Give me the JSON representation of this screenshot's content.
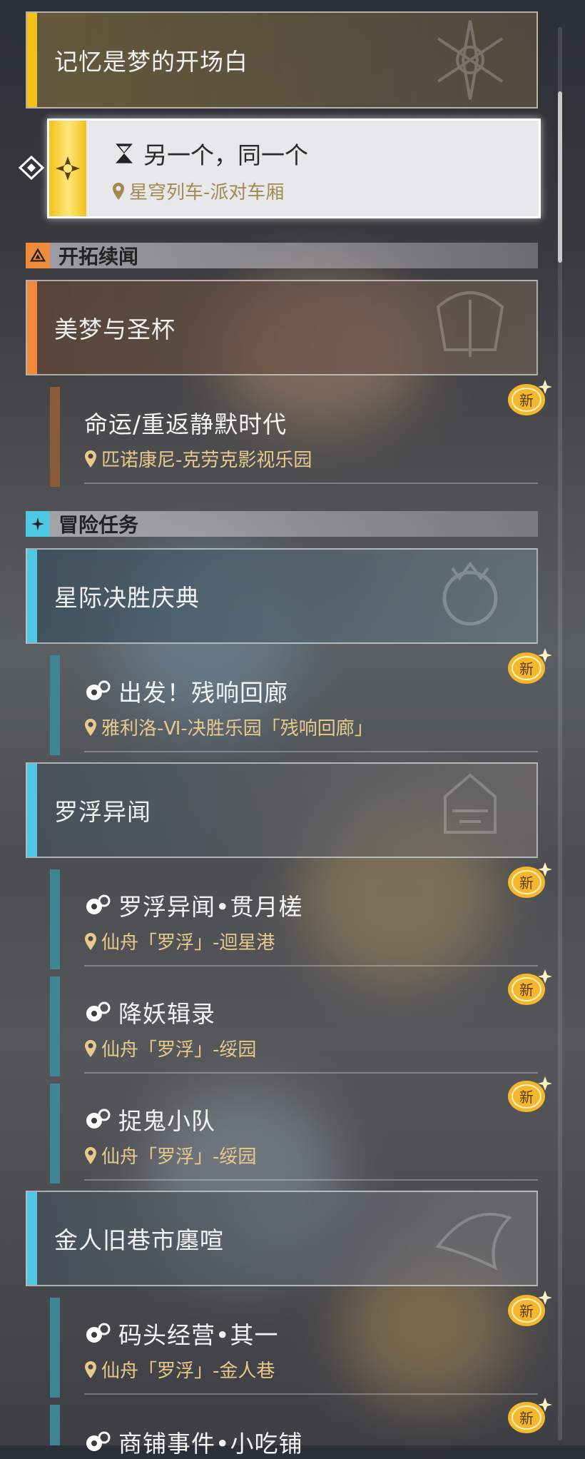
{
  "colors": {
    "accent_gold": "#f2c21a",
    "trailblaze_orange": "#f08a3c",
    "adventure_cyan": "#4fc9e3",
    "quest_bar_brown": "#8b5a3a",
    "quest_bar_teal": "#3f8596",
    "location_gold": "#e7c98c",
    "new_badge": "#f5b72b"
  },
  "top_chapter": {
    "title": "记忆是梦的开场白",
    "icon": "emblem-icon"
  },
  "selected_quest": {
    "name": "另一个，同一个",
    "location": "星穹列车-派对车厢",
    "icon": "hourglass-icon"
  },
  "sections": [
    {
      "label": "开拓续闻",
      "icon": "trailblaze-icon",
      "chapters": [
        {
          "title": "美梦与圣杯",
          "quests": [
            {
              "name": "命运/重返静默时代",
              "location": "匹诺康尼-克劳克影视乐园",
              "badge": "新",
              "has_type_icon": false
            }
          ]
        }
      ]
    },
    {
      "label": "冒险任务",
      "icon": "adventure-icon",
      "chapters": [
        {
          "title": "星际决胜庆典",
          "quests": [
            {
              "name": "出发！残响回廊",
              "location": "雅利洛-Ⅵ-决胜乐园「残响回廊」",
              "badge": "新",
              "has_type_icon": true
            }
          ]
        },
        {
          "title": "罗浮异闻",
          "quests": [
            {
              "name": "罗浮异闻•贯月槎",
              "location": "仙舟「罗浮」-迴星港",
              "badge": "新",
              "has_type_icon": true
            },
            {
              "name": "降妖辑录",
              "location": "仙舟「罗浮」-绥园",
              "badge": "新",
              "has_type_icon": true
            },
            {
              "name": "捉鬼小队",
              "location": "仙舟「罗浮」-绥园",
              "badge": "新",
              "has_type_icon": true
            }
          ]
        },
        {
          "title": "金人旧巷市廛喧",
          "quests": [
            {
              "name": "码头经营•其一",
              "location": "仙舟「罗浮」-金人巷",
              "badge": "新",
              "has_type_icon": true
            },
            {
              "name": "商铺事件•小吃铺",
              "location": "",
              "badge": "新",
              "has_type_icon": true
            }
          ]
        }
      ]
    }
  ]
}
